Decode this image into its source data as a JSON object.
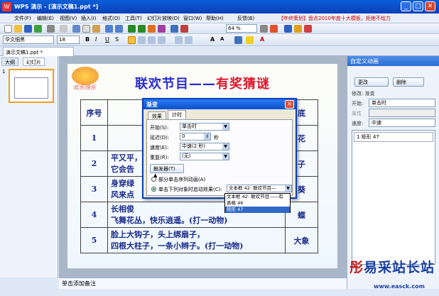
{
  "window": {
    "title": "WPS 演示 - [演示文稿1.ppt *]",
    "logo": "W"
  },
  "menu": [
    "文件(F)",
    "编辑(E)",
    "视图(V)",
    "插入(I)",
    "格式(O)",
    "工具(T)",
    "幻灯片放映(D)",
    "窗口(W)",
    "帮助(H)",
    "反馈(B)"
  ],
  "promo": "【年终策划】盘点2010年度十大模板，拒绝不给力",
  "toolbar": {
    "zoom": "64 %",
    "font": "华文细黑",
    "size": "18"
  },
  "doc_tab": "演示文稿1.ppt *",
  "left_tabs": [
    "大纲",
    "幻灯片"
  ],
  "slide_number": "1",
  "slide": {
    "logo_text": "欢乐快乐",
    "title_a": "联欢节目——",
    "title_b": "有奖猜谜",
    "header_no": "序号",
    "header_end": "底",
    "rows": [
      {
        "no": "1",
        "text": "",
        "end": "花"
      },
      {
        "no": "2",
        "text": "平又平，\n它会告",
        "end": "子"
      },
      {
        "no": "3",
        "text": "身穿绿\n风来点",
        "end": "葵"
      },
      {
        "no": "4",
        "text": "长相俊\n飞舞花丛，快乐逍遥。(打一动物)",
        "end": "蝶"
      },
      {
        "no": "5",
        "text": "脸上大钩子，头上绑扇子，\n四根大柱子，一条小辫子。(打一动物)",
        "end": "大象"
      }
    ]
  },
  "notes_placeholder": "单击添加备注",
  "panel": {
    "title": "自定义动画",
    "change_btn": "更改",
    "delete_btn": "删除",
    "modify_label": "修改: 渐变",
    "start_label": "开始:",
    "start_value": "单击时",
    "prop_label": "属性",
    "speed_label": "速度:",
    "speed_value": "中速",
    "list_item": "1  矩形 47"
  },
  "dialog": {
    "title": "渐变",
    "tabs": [
      "效果",
      "计时"
    ],
    "start_label": "开始(S):",
    "start_value": "单击时",
    "delay_label": "延迟(D):",
    "delay_value": "0",
    "delay_unit": "秒",
    "speed_label": "速度(E):",
    "speed_value": "中速(2 秒)",
    "repeat_label": "重复(R):",
    "repeat_value": "(无)",
    "trigger_btn": "触发器(T) ▲",
    "radio1": "部分单击序列动画(A)",
    "radio2": "单击下列对象时启动效果(C):",
    "trigger_value": "文本框 42: 联欢节目—",
    "dropdown": [
      "文本框 42: 联欢节目——有",
      "表格 46",
      "矩形 47"
    ],
    "dropdown_selected": 2
  },
  "watermark": {
    "a": "易采站长站",
    "url": "www.easck.com"
  }
}
